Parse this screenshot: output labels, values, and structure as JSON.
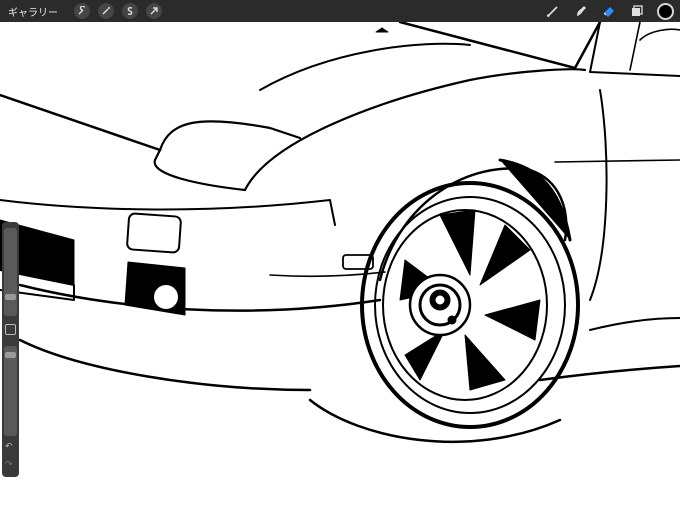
{
  "app": {
    "gallery_label": "ギャラリー"
  },
  "toolbar": {
    "left_tools": [
      "wrench-icon",
      "magic-wand-icon",
      "selection-s-icon",
      "transform-arrow-icon"
    ],
    "right_tools": [
      "brush-icon",
      "smudge-icon",
      "eraser-icon",
      "layers-icon"
    ],
    "active_tool": "eraser-icon",
    "active_color": "#000000",
    "accent": "#2f8cff"
  },
  "sidebar": {
    "undo_icon": "undo-icon",
    "redo_icon": "redo-icon"
  }
}
